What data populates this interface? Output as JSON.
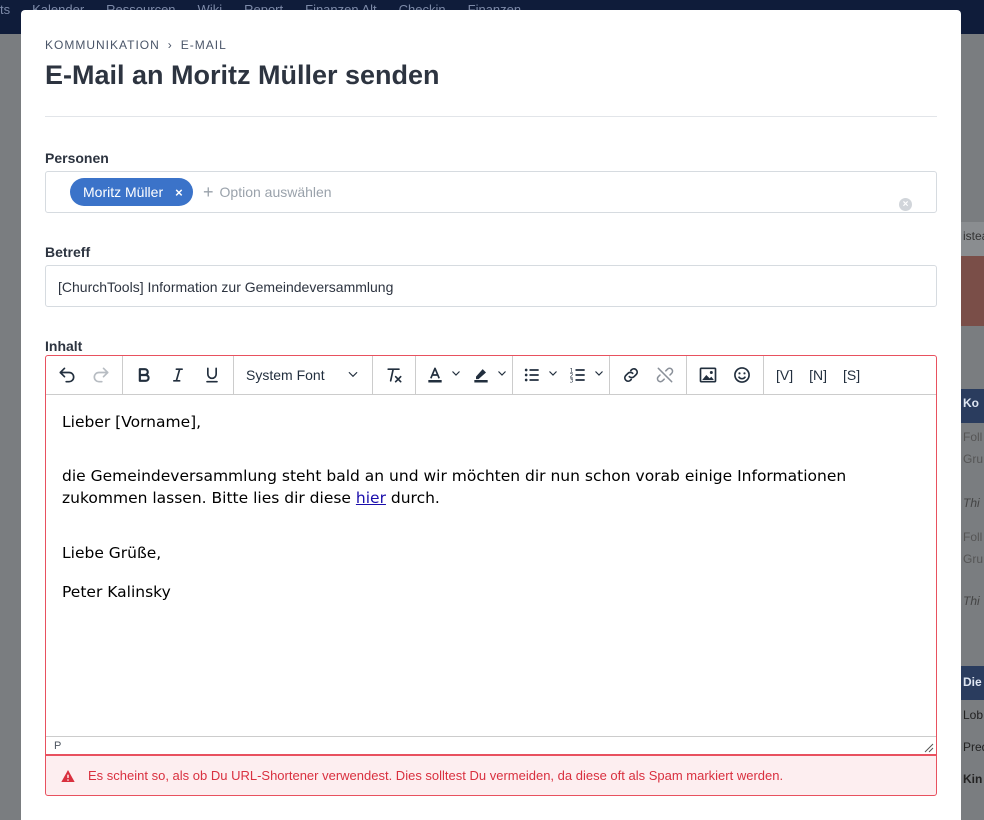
{
  "background": {
    "topnav": [
      "ts",
      "Kalender",
      "Ressourcen",
      "Wiki",
      "Report",
      "Finanzen Alt",
      "Checkin",
      "Finanzen"
    ],
    "right_text": [
      "isteat",
      "Ko",
      "Foll",
      "Gru",
      "Thi",
      "Foll",
      "Gru",
      "Thi",
      "Die",
      "Lob",
      "Pred",
      "Kin"
    ]
  },
  "breadcrumb": {
    "items": [
      "KOMMUNIKATION",
      "E-MAIL"
    ],
    "separator": "›"
  },
  "title": "E-Mail an Moritz Müller senden",
  "persons": {
    "label": "Personen",
    "tag": "Moritz Müller",
    "tag_remove": "×",
    "add_placeholder": "Option auswählen",
    "clear": "×"
  },
  "subject": {
    "label": "Betreff",
    "value": "[ChurchTools] Information zur Gemeindeversammlung"
  },
  "content": {
    "label": "Inhalt",
    "toolbar": {
      "font": "System Font",
      "var_v": "[V]",
      "var_n": "[N]",
      "var_s": "[S]"
    },
    "body": {
      "greeting": "Lieber [Vorname],",
      "line1": "die Gemeindeversammlung steht bald an und wir möchten dir nun schon vorab einige Informationen zukommen lassen. Bitte lies dir diese",
      "link": "hier",
      "line1_end": "durch.",
      "closing": "Liebe Grüße,",
      "signature": "Peter Kalinsky"
    },
    "status_path": "P"
  },
  "alert": {
    "text": "Es scheint so, als ob Du URL-Shortener verwendest. Dies solltest Du vermeiden, da diese oft als Spam markiert werden.",
    "color": "#d9303f"
  },
  "colors": {
    "accent": "#3b73c9",
    "error": "#e8515f"
  }
}
